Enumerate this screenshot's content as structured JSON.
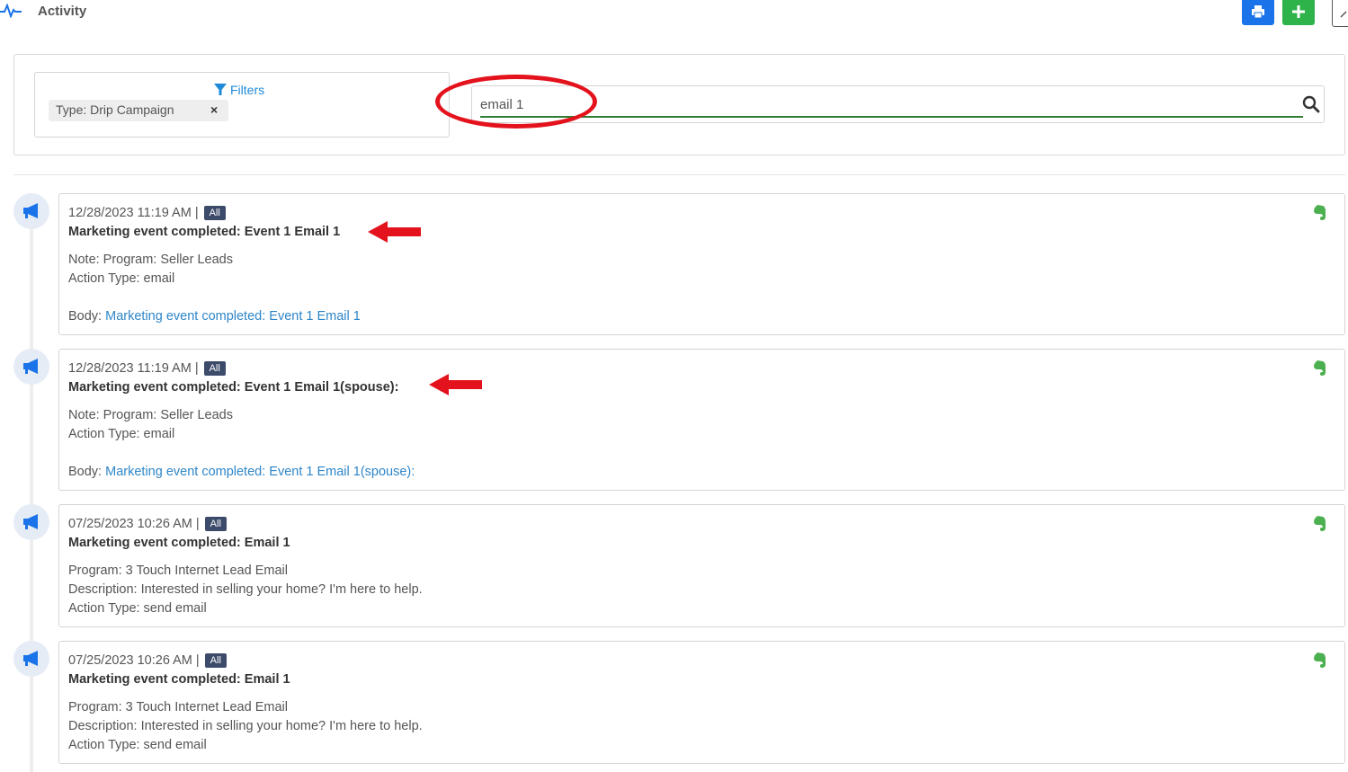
{
  "header": {
    "title": "Activity",
    "print_icon": "print-icon",
    "add_icon": "plus-icon"
  },
  "filters": {
    "link_label": "Filters",
    "chips": [
      {
        "label": "Type: Drip Campaign",
        "remove": "×"
      }
    ]
  },
  "search": {
    "value": "email 1"
  },
  "colors": {
    "primary": "#1a73e8",
    "success": "#2db34a",
    "link": "#2e86c9",
    "annotation": "#e3121c",
    "badge": "#3d4b6b"
  },
  "activities": [
    {
      "date": "12/28/2023 11:19 AM |",
      "badge": "All",
      "title": "Marketing event completed: Event 1 Email 1",
      "lines": [
        "Note: Program: Seller Leads",
        "Action Type: email"
      ],
      "body_label": "Body:",
      "body_link": "Marketing event completed: Event 1 Email 1"
    },
    {
      "date": "12/28/2023 11:19 AM |",
      "badge": "All",
      "title": "Marketing event completed: Event 1 Email 1(spouse):",
      "lines": [
        "Note: Program: Seller Leads",
        "Action Type: email"
      ],
      "body_label": "Body:",
      "body_link": "Marketing event completed: Event 1 Email 1(spouse):"
    },
    {
      "date": "07/25/2023 10:26 AM |",
      "badge": "All",
      "title": "Marketing event completed: Email 1",
      "lines": [
        "Program: 3 Touch Internet Lead Email",
        "Description: Interested in selling your home? I'm here to help.",
        "Action Type: send email"
      ]
    },
    {
      "date": "07/25/2023 10:26 AM |",
      "badge": "All",
      "title": "Marketing event completed: Email 1",
      "lines": [
        "Program: 3 Touch Internet Lead Email",
        "Description: Interested in selling your home? I'm here to help.",
        "Action Type: send email"
      ]
    }
  ]
}
